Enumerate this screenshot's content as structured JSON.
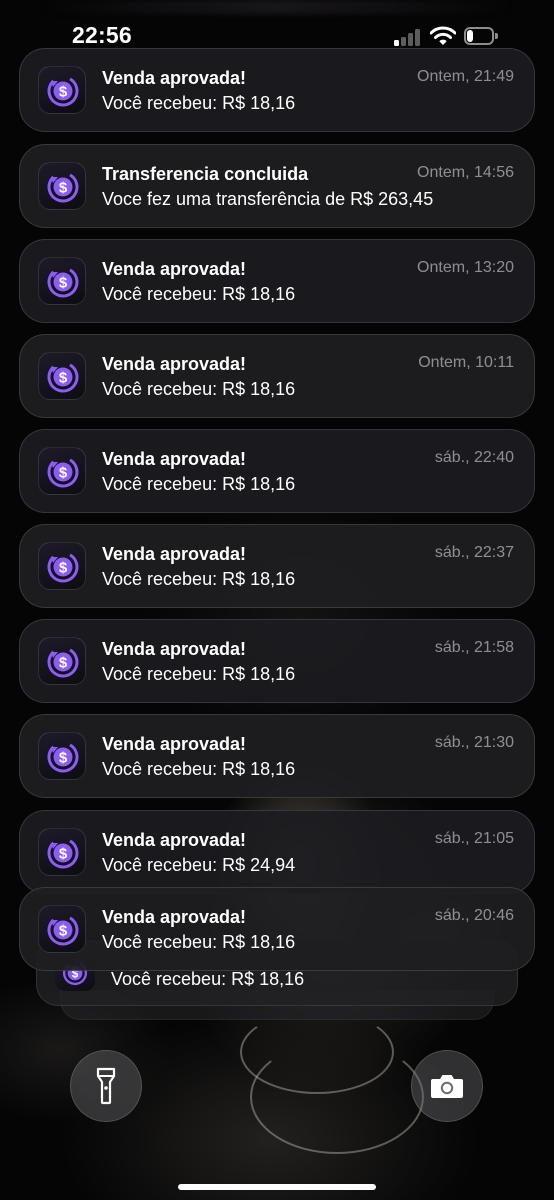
{
  "status_bar": {
    "time": "22:56",
    "signal_bars_active": 1,
    "signal_bars_total": 4,
    "battery_level": 0.25
  },
  "app": {
    "icon": "dollar-refresh-icon",
    "accent_color": "#8b5cf6"
  },
  "notifications": [
    {
      "title": "Venda aprovada!",
      "body": "Você recebeu: R$ 18,16",
      "time": "Ontem, 21:49"
    },
    {
      "title": "Transferencia concluida",
      "body": "Voce fez uma transferência de R$ 263,45",
      "time": "Ontem, 14:56"
    },
    {
      "title": "Venda aprovada!",
      "body": "Você recebeu: R$ 18,16",
      "time": "Ontem, 13:20"
    },
    {
      "title": "Venda aprovada!",
      "body": "Você recebeu: R$ 18,16",
      "time": "Ontem, 10:11"
    },
    {
      "title": "Venda aprovada!",
      "body": "Você recebeu: R$ 18,16",
      "time": "sáb., 22:40"
    },
    {
      "title": "Venda aprovada!",
      "body": "Você recebeu: R$ 18,16",
      "time": "sáb., 22:37"
    },
    {
      "title": "Venda aprovada!",
      "body": "Você recebeu: R$ 18,16",
      "time": "sáb., 21:58"
    },
    {
      "title": "Venda aprovada!",
      "body": "Você recebeu: R$ 18,16",
      "time": "sáb., 21:30"
    },
    {
      "title": "Venda aprovada!",
      "body": "Você recebeu: R$ 24,94",
      "time": "sáb., 21:05"
    },
    {
      "title": "Venda aprovada!",
      "body": "Você recebeu: R$ 18,16",
      "time": "sáb., 20:46"
    }
  ],
  "stacked_notification": {
    "body": "Você recebeu: R$ 18,16"
  },
  "lock_screen": {
    "left_button_icon": "flashlight-icon",
    "right_button_icon": "camera-icon"
  }
}
